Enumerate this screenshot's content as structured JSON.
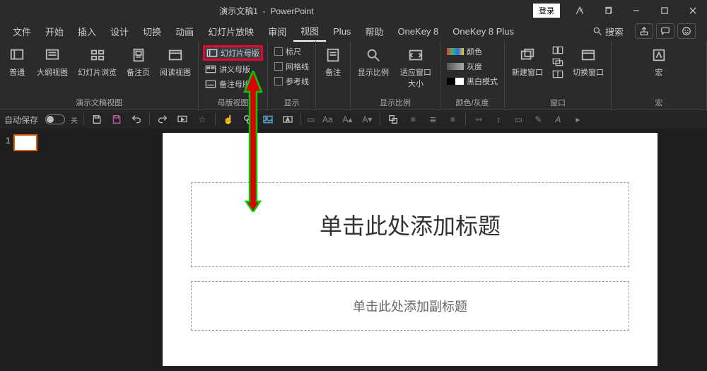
{
  "titlebar": {
    "doc": "演示文稿1",
    "app": "PowerPoint",
    "login": "登录"
  },
  "menubar": {
    "tabs": [
      "文件",
      "开始",
      "插入",
      "设计",
      "切换",
      "动画",
      "幻灯片放映",
      "审阅",
      "视图",
      "Plus",
      "帮助",
      "OneKey 8",
      "OneKey 8 Plus"
    ],
    "active_index": 8,
    "search": "搜索"
  },
  "ribbon": {
    "groups": {
      "pres_views": {
        "label": "演示文稿视图",
        "buttons": [
          "普通",
          "大纲视图",
          "幻灯片浏览",
          "备注页",
          "阅读视图"
        ]
      },
      "master_views": {
        "label": "母版视图",
        "items": [
          "幻灯片母版",
          "讲义母版",
          "备注母版"
        ],
        "highlighted_index": 0
      },
      "show": {
        "label": "显示",
        "items": [
          "标尺",
          "网格线",
          "参考线"
        ]
      },
      "notes": {
        "label": "备注"
      },
      "zoom": {
        "label": "显示比例",
        "buttons": [
          "显示比例",
          "适应窗口大小"
        ]
      },
      "color": {
        "label": "颜色/灰度",
        "items": [
          "颜色",
          "灰度",
          "黑白模式"
        ]
      },
      "window": {
        "label": "窗口",
        "buttons": [
          "新建窗口",
          "切换窗口"
        ]
      },
      "macro": {
        "label": "宏",
        "button": "宏"
      }
    }
  },
  "qat": {
    "autosave_label": "自动保存",
    "autosave_state": "关",
    "font_label": "Aa"
  },
  "thumbs": {
    "items": [
      {
        "num": "1"
      }
    ]
  },
  "slide": {
    "title_placeholder": "单击此处添加标题",
    "subtitle_placeholder": "单击此处添加副标题"
  }
}
